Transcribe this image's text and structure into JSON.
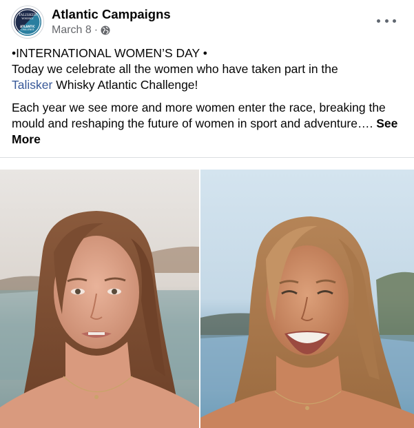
{
  "post": {
    "page_name": "Atlantic Campaigns",
    "date": "March 8",
    "separator": "·",
    "privacy_icon": "globe-icon",
    "more_icon": "more-horizontal-icon",
    "avatar": {
      "logo_line1": "TALISKER",
      "logo_line2": "WHISKY",
      "logo_line3": "ATLANTIC",
      "logo_line4": "CHALLENGE",
      "colors": {
        "navy": "#1d2a4a",
        "teal": "#2a7fa0",
        "white": "#ffffff"
      }
    },
    "text": {
      "line1": "•INTERNATIONAL WOMEN’S DAY •",
      "line2": "Today we celebrate all the women who have taken part in the",
      "link": "Talisker",
      "line3_rest": " Whisky Atlantic Challenge!",
      "para2": "Each year we see more and more women enter the race, breaking the mould and reshaping the future of women in sport and adventure…. ",
      "see_more": "See More"
    },
    "photos": [
      {
        "name": "portrait-left",
        "description_icon": "photo"
      },
      {
        "name": "portrait-right",
        "description_icon": "photo"
      }
    ],
    "colors": {
      "link": "#385898",
      "secondary": "#65676b",
      "divider": "#dadde1"
    }
  }
}
